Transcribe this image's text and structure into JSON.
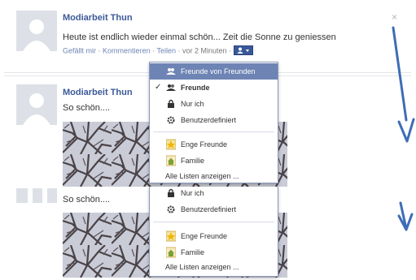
{
  "post1": {
    "author": "Modiarbeit Thun",
    "text": "Heute ist endlich wieder einmal schön... Zeit die Sonne zu geniessen",
    "like": "Gefällt mir",
    "comments": "Kommentieren",
    "share": "Teilen",
    "time": "vor 2 Minuten",
    "sep": "·",
    "close": "×"
  },
  "post2": {
    "author": "Modiarbeit Thun",
    "text": "So schön...."
  },
  "post3": {
    "text": "So schön...."
  },
  "menu_full": {
    "items": [
      {
        "label": "Freunde von Freunden",
        "icon": "friends-of-friends-icon",
        "selected": true
      },
      {
        "label": "Freunde",
        "icon": "friends-icon",
        "checked": true
      },
      {
        "label": "Nur ich",
        "icon": "lock-icon"
      },
      {
        "label": "Benutzerdefiniert",
        "icon": "gear-icon"
      },
      {
        "label": "Enge Freunde",
        "icon": "star-icon"
      },
      {
        "label": "Familie",
        "icon": "home-icon"
      },
      {
        "label": "Alle Listen anzeigen ..."
      }
    ],
    "check": "✓"
  },
  "menu_partial": {
    "items": [
      {
        "label": "Nur ich",
        "icon": "lock-icon"
      },
      {
        "label": "Benutzerdefiniert",
        "icon": "gear-icon"
      },
      {
        "label": "Enge Freunde",
        "icon": "star-icon"
      },
      {
        "label": "Familie",
        "icon": "home-icon"
      },
      {
        "label": "Alle Listen anzeigen ..."
      }
    ]
  },
  "colors": {
    "link": "#3b5998",
    "menu_highlight": "#6d84b4",
    "annotation_arrow": "#3d6db5"
  }
}
